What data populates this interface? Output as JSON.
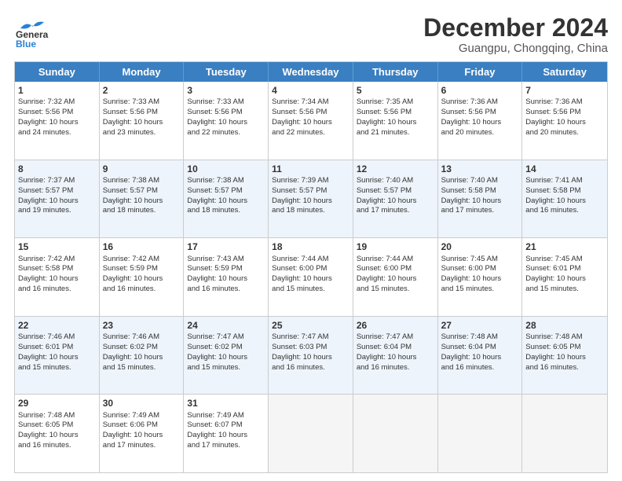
{
  "header": {
    "logo_general": "General",
    "logo_blue": "Blue",
    "month_title": "December 2024",
    "location": "Guangpu, Chongqing, China"
  },
  "weekdays": [
    "Sunday",
    "Monday",
    "Tuesday",
    "Wednesday",
    "Thursday",
    "Friday",
    "Saturday"
  ],
  "rows": [
    {
      "alt": false,
      "cells": [
        {
          "day": 1,
          "lines": [
            "Sunrise: 7:32 AM",
            "Sunset: 5:56 PM",
            "Daylight: 10 hours",
            "and 24 minutes."
          ]
        },
        {
          "day": 2,
          "lines": [
            "Sunrise: 7:33 AM",
            "Sunset: 5:56 PM",
            "Daylight: 10 hours",
            "and 23 minutes."
          ]
        },
        {
          "day": 3,
          "lines": [
            "Sunrise: 7:33 AM",
            "Sunset: 5:56 PM",
            "Daylight: 10 hours",
            "and 22 minutes."
          ]
        },
        {
          "day": 4,
          "lines": [
            "Sunrise: 7:34 AM",
            "Sunset: 5:56 PM",
            "Daylight: 10 hours",
            "and 22 minutes."
          ]
        },
        {
          "day": 5,
          "lines": [
            "Sunrise: 7:35 AM",
            "Sunset: 5:56 PM",
            "Daylight: 10 hours",
            "and 21 minutes."
          ]
        },
        {
          "day": 6,
          "lines": [
            "Sunrise: 7:36 AM",
            "Sunset: 5:56 PM",
            "Daylight: 10 hours",
            "and 20 minutes."
          ]
        },
        {
          "day": 7,
          "lines": [
            "Sunrise: 7:36 AM",
            "Sunset: 5:56 PM",
            "Daylight: 10 hours",
            "and 20 minutes."
          ]
        }
      ]
    },
    {
      "alt": true,
      "cells": [
        {
          "day": 8,
          "lines": [
            "Sunrise: 7:37 AM",
            "Sunset: 5:57 PM",
            "Daylight: 10 hours",
            "and 19 minutes."
          ]
        },
        {
          "day": 9,
          "lines": [
            "Sunrise: 7:38 AM",
            "Sunset: 5:57 PM",
            "Daylight: 10 hours",
            "and 18 minutes."
          ]
        },
        {
          "day": 10,
          "lines": [
            "Sunrise: 7:38 AM",
            "Sunset: 5:57 PM",
            "Daylight: 10 hours",
            "and 18 minutes."
          ]
        },
        {
          "day": 11,
          "lines": [
            "Sunrise: 7:39 AM",
            "Sunset: 5:57 PM",
            "Daylight: 10 hours",
            "and 18 minutes."
          ]
        },
        {
          "day": 12,
          "lines": [
            "Sunrise: 7:40 AM",
            "Sunset: 5:57 PM",
            "Daylight: 10 hours",
            "and 17 minutes."
          ]
        },
        {
          "day": 13,
          "lines": [
            "Sunrise: 7:40 AM",
            "Sunset: 5:58 PM",
            "Daylight: 10 hours",
            "and 17 minutes."
          ]
        },
        {
          "day": 14,
          "lines": [
            "Sunrise: 7:41 AM",
            "Sunset: 5:58 PM",
            "Daylight: 10 hours",
            "and 16 minutes."
          ]
        }
      ]
    },
    {
      "alt": false,
      "cells": [
        {
          "day": 15,
          "lines": [
            "Sunrise: 7:42 AM",
            "Sunset: 5:58 PM",
            "Daylight: 10 hours",
            "and 16 minutes."
          ]
        },
        {
          "day": 16,
          "lines": [
            "Sunrise: 7:42 AM",
            "Sunset: 5:59 PM",
            "Daylight: 10 hours",
            "and 16 minutes."
          ]
        },
        {
          "day": 17,
          "lines": [
            "Sunrise: 7:43 AM",
            "Sunset: 5:59 PM",
            "Daylight: 10 hours",
            "and 16 minutes."
          ]
        },
        {
          "day": 18,
          "lines": [
            "Sunrise: 7:44 AM",
            "Sunset: 6:00 PM",
            "Daylight: 10 hours",
            "and 15 minutes."
          ]
        },
        {
          "day": 19,
          "lines": [
            "Sunrise: 7:44 AM",
            "Sunset: 6:00 PM",
            "Daylight: 10 hours",
            "and 15 minutes."
          ]
        },
        {
          "day": 20,
          "lines": [
            "Sunrise: 7:45 AM",
            "Sunset: 6:00 PM",
            "Daylight: 10 hours",
            "and 15 minutes."
          ]
        },
        {
          "day": 21,
          "lines": [
            "Sunrise: 7:45 AM",
            "Sunset: 6:01 PM",
            "Daylight: 10 hours",
            "and 15 minutes."
          ]
        }
      ]
    },
    {
      "alt": true,
      "cells": [
        {
          "day": 22,
          "lines": [
            "Sunrise: 7:46 AM",
            "Sunset: 6:01 PM",
            "Daylight: 10 hours",
            "and 15 minutes."
          ]
        },
        {
          "day": 23,
          "lines": [
            "Sunrise: 7:46 AM",
            "Sunset: 6:02 PM",
            "Daylight: 10 hours",
            "and 15 minutes."
          ]
        },
        {
          "day": 24,
          "lines": [
            "Sunrise: 7:47 AM",
            "Sunset: 6:02 PM",
            "Daylight: 10 hours",
            "and 15 minutes."
          ]
        },
        {
          "day": 25,
          "lines": [
            "Sunrise: 7:47 AM",
            "Sunset: 6:03 PM",
            "Daylight: 10 hours",
            "and 16 minutes."
          ]
        },
        {
          "day": 26,
          "lines": [
            "Sunrise: 7:47 AM",
            "Sunset: 6:04 PM",
            "Daylight: 10 hours",
            "and 16 minutes."
          ]
        },
        {
          "day": 27,
          "lines": [
            "Sunrise: 7:48 AM",
            "Sunset: 6:04 PM",
            "Daylight: 10 hours",
            "and 16 minutes."
          ]
        },
        {
          "day": 28,
          "lines": [
            "Sunrise: 7:48 AM",
            "Sunset: 6:05 PM",
            "Daylight: 10 hours",
            "and 16 minutes."
          ]
        }
      ]
    },
    {
      "alt": false,
      "cells": [
        {
          "day": 29,
          "lines": [
            "Sunrise: 7:48 AM",
            "Sunset: 6:05 PM",
            "Daylight: 10 hours",
            "and 16 minutes."
          ]
        },
        {
          "day": 30,
          "lines": [
            "Sunrise: 7:49 AM",
            "Sunset: 6:06 PM",
            "Daylight: 10 hours",
            "and 17 minutes."
          ]
        },
        {
          "day": 31,
          "lines": [
            "Sunrise: 7:49 AM",
            "Sunset: 6:07 PM",
            "Daylight: 10 hours",
            "and 17 minutes."
          ]
        },
        null,
        null,
        null,
        null
      ]
    }
  ]
}
